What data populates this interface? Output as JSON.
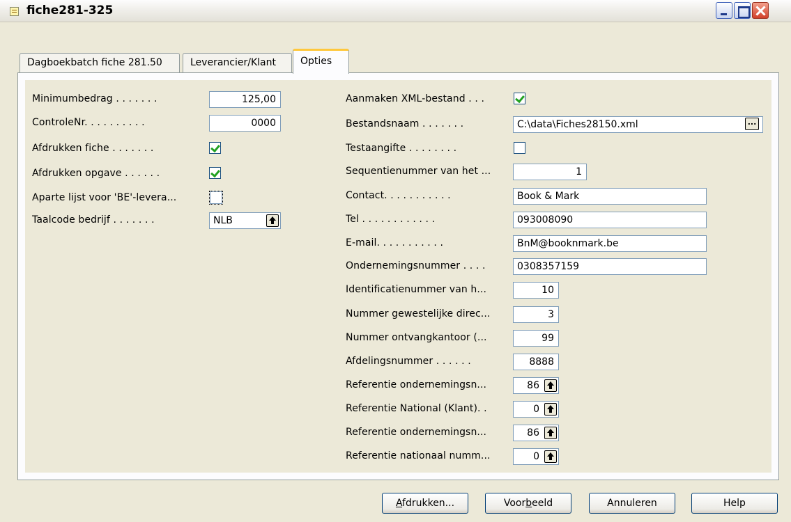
{
  "window": {
    "title": "fiche281-325"
  },
  "tabs": [
    {
      "label": "Dagboekbatch fiche 281.50"
    },
    {
      "label": "Leverancier/Klant"
    },
    {
      "label": "Opties"
    }
  ],
  "left_fields": {
    "minimumbedrag": {
      "label": "Minimumbedrag . . . . . . .",
      "value": "125,00"
    },
    "controlenr": {
      "label": "ControleNr. . . . . . . . . .",
      "value": "0000"
    },
    "afdrukken_fiche": {
      "label": "Afdrukken fiche . . . . . . .",
      "checked": true
    },
    "afdrukken_opgave": {
      "label": "Afdrukken opgave . . . . . .",
      "checked": true
    },
    "aparte_lijst": {
      "label": "Aparte lijst voor 'BE'-levera...",
      "checked": false
    },
    "taalcode": {
      "label": "Taalcode bedrijf . . . . . . .",
      "value": "NLB"
    }
  },
  "right_fields": {
    "xml": {
      "label": "Aanmaken XML-bestand . . .",
      "checked": true
    },
    "bestandsnaam": {
      "label": "Bestandsnaam . . . . . . .",
      "value": "C:\\data\\Fiches28150.xml",
      "button": "..."
    },
    "testaangifte": {
      "label": "Testaangifte . . . . . . . .",
      "checked": false
    },
    "sequentienummer": {
      "label": "Sequentienummer van het ...",
      "value": "1"
    },
    "contact": {
      "label": "Contact. . . . . . . . . . .",
      "value": "Book & Mark"
    },
    "tel": {
      "label": "Tel . . . . . . . . . . . .",
      "value": "093008090"
    },
    "email": {
      "label": "E-mail. . . . . . . . . . .",
      "value": "BnM@booknmark.be"
    },
    "ondernemingsnummer": {
      "label": "Ondernemingsnummer . . . .",
      "value": "0308357159"
    },
    "identificatienummer": {
      "label": "Identificatienummer van h...",
      "value": "10"
    },
    "gewestelijke": {
      "label": "Nummer gewestelijke direc...",
      "value": "3"
    },
    "ontvangkantoor": {
      "label": "Nummer ontvangkantoor (...",
      "value": "99"
    },
    "afdelingsnummer": {
      "label": "Afdelingsnummer . . . . . .",
      "value": "8888"
    },
    "ref_onderneming1": {
      "label": "Referentie ondernemingsn...",
      "value": "86"
    },
    "ref_national": {
      "label": "Referentie National (Klant). .",
      "value": "0"
    },
    "ref_onderneming2": {
      "label": "Referentie ondernemingsn...",
      "value": "86"
    },
    "ref_nationaal": {
      "label": "Referentie nationaal numm...",
      "value": "0"
    }
  },
  "buttons": {
    "afdrukken": {
      "pre": "",
      "u": "A",
      "post": "fdrukken..."
    },
    "voorbeeld": {
      "pre": "Voor",
      "u": "b",
      "post": "eeld"
    },
    "annuleren": {
      "label": "Annuleren"
    },
    "help": {
      "label": "Help"
    }
  },
  "colors": {
    "window_bg": "#ECE9D8",
    "checkmark": "#21A121",
    "active_tab_accent": "#FFC83C"
  }
}
